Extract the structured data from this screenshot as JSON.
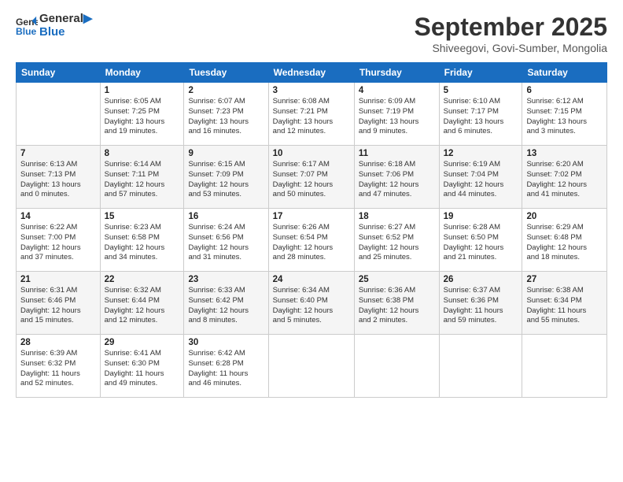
{
  "logo": {
    "line1": "General",
    "line2": "Blue"
  },
  "title": "September 2025",
  "subtitle": "Shiveegovi, Govi-Sumber, Mongolia",
  "days_of_week": [
    "Sunday",
    "Monday",
    "Tuesday",
    "Wednesday",
    "Thursday",
    "Friday",
    "Saturday"
  ],
  "weeks": [
    [
      {
        "day": "",
        "info": ""
      },
      {
        "day": "1",
        "info": "Sunrise: 6:05 AM\nSunset: 7:25 PM\nDaylight: 13 hours\nand 19 minutes."
      },
      {
        "day": "2",
        "info": "Sunrise: 6:07 AM\nSunset: 7:23 PM\nDaylight: 13 hours\nand 16 minutes."
      },
      {
        "day": "3",
        "info": "Sunrise: 6:08 AM\nSunset: 7:21 PM\nDaylight: 13 hours\nand 12 minutes."
      },
      {
        "day": "4",
        "info": "Sunrise: 6:09 AM\nSunset: 7:19 PM\nDaylight: 13 hours\nand 9 minutes."
      },
      {
        "day": "5",
        "info": "Sunrise: 6:10 AM\nSunset: 7:17 PM\nDaylight: 13 hours\nand 6 minutes."
      },
      {
        "day": "6",
        "info": "Sunrise: 6:12 AM\nSunset: 7:15 PM\nDaylight: 13 hours\nand 3 minutes."
      }
    ],
    [
      {
        "day": "7",
        "info": "Sunrise: 6:13 AM\nSunset: 7:13 PM\nDaylight: 13 hours\nand 0 minutes."
      },
      {
        "day": "8",
        "info": "Sunrise: 6:14 AM\nSunset: 7:11 PM\nDaylight: 12 hours\nand 57 minutes."
      },
      {
        "day": "9",
        "info": "Sunrise: 6:15 AM\nSunset: 7:09 PM\nDaylight: 12 hours\nand 53 minutes."
      },
      {
        "day": "10",
        "info": "Sunrise: 6:17 AM\nSunset: 7:07 PM\nDaylight: 12 hours\nand 50 minutes."
      },
      {
        "day": "11",
        "info": "Sunrise: 6:18 AM\nSunset: 7:06 PM\nDaylight: 12 hours\nand 47 minutes."
      },
      {
        "day": "12",
        "info": "Sunrise: 6:19 AM\nSunset: 7:04 PM\nDaylight: 12 hours\nand 44 minutes."
      },
      {
        "day": "13",
        "info": "Sunrise: 6:20 AM\nSunset: 7:02 PM\nDaylight: 12 hours\nand 41 minutes."
      }
    ],
    [
      {
        "day": "14",
        "info": "Sunrise: 6:22 AM\nSunset: 7:00 PM\nDaylight: 12 hours\nand 37 minutes."
      },
      {
        "day": "15",
        "info": "Sunrise: 6:23 AM\nSunset: 6:58 PM\nDaylight: 12 hours\nand 34 minutes."
      },
      {
        "day": "16",
        "info": "Sunrise: 6:24 AM\nSunset: 6:56 PM\nDaylight: 12 hours\nand 31 minutes."
      },
      {
        "day": "17",
        "info": "Sunrise: 6:26 AM\nSunset: 6:54 PM\nDaylight: 12 hours\nand 28 minutes."
      },
      {
        "day": "18",
        "info": "Sunrise: 6:27 AM\nSunset: 6:52 PM\nDaylight: 12 hours\nand 25 minutes."
      },
      {
        "day": "19",
        "info": "Sunrise: 6:28 AM\nSunset: 6:50 PM\nDaylight: 12 hours\nand 21 minutes."
      },
      {
        "day": "20",
        "info": "Sunrise: 6:29 AM\nSunset: 6:48 PM\nDaylight: 12 hours\nand 18 minutes."
      }
    ],
    [
      {
        "day": "21",
        "info": "Sunrise: 6:31 AM\nSunset: 6:46 PM\nDaylight: 12 hours\nand 15 minutes."
      },
      {
        "day": "22",
        "info": "Sunrise: 6:32 AM\nSunset: 6:44 PM\nDaylight: 12 hours\nand 12 minutes."
      },
      {
        "day": "23",
        "info": "Sunrise: 6:33 AM\nSunset: 6:42 PM\nDaylight: 12 hours\nand 8 minutes."
      },
      {
        "day": "24",
        "info": "Sunrise: 6:34 AM\nSunset: 6:40 PM\nDaylight: 12 hours\nand 5 minutes."
      },
      {
        "day": "25",
        "info": "Sunrise: 6:36 AM\nSunset: 6:38 PM\nDaylight: 12 hours\nand 2 minutes."
      },
      {
        "day": "26",
        "info": "Sunrise: 6:37 AM\nSunset: 6:36 PM\nDaylight: 11 hours\nand 59 minutes."
      },
      {
        "day": "27",
        "info": "Sunrise: 6:38 AM\nSunset: 6:34 PM\nDaylight: 11 hours\nand 55 minutes."
      }
    ],
    [
      {
        "day": "28",
        "info": "Sunrise: 6:39 AM\nSunset: 6:32 PM\nDaylight: 11 hours\nand 52 minutes."
      },
      {
        "day": "29",
        "info": "Sunrise: 6:41 AM\nSunset: 6:30 PM\nDaylight: 11 hours\nand 49 minutes."
      },
      {
        "day": "30",
        "info": "Sunrise: 6:42 AM\nSunset: 6:28 PM\nDaylight: 11 hours\nand 46 minutes."
      },
      {
        "day": "",
        "info": ""
      },
      {
        "day": "",
        "info": ""
      },
      {
        "day": "",
        "info": ""
      },
      {
        "day": "",
        "info": ""
      }
    ]
  ]
}
